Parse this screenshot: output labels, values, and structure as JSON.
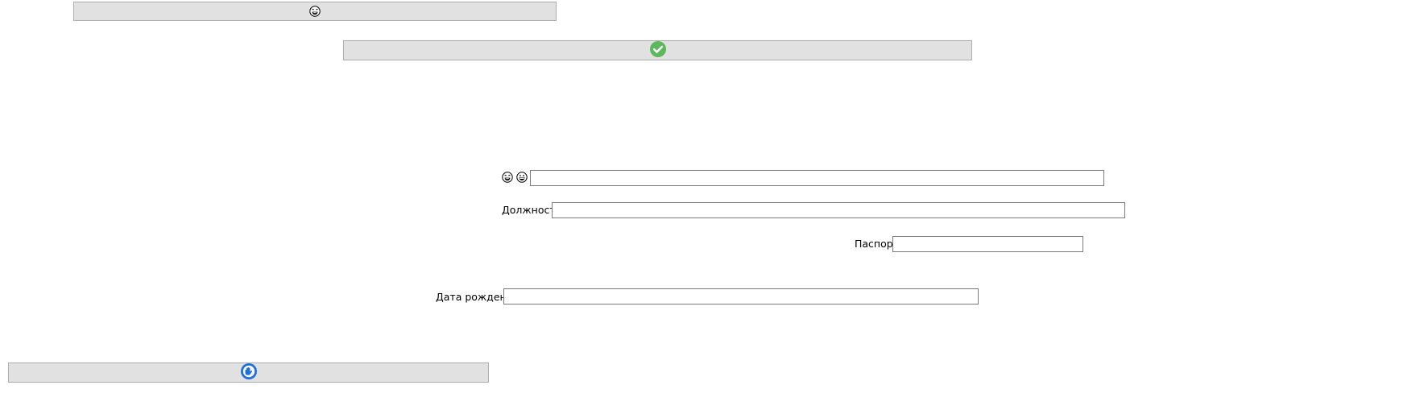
{
  "buttons": {
    "top_button_icon": "laughing-face-icon",
    "confirm_button_icon": "green-checkmark-icon",
    "bottom_button_icon": "blue-round-hand-icon"
  },
  "form": {
    "row1_icons": [
      "laughing-face-icon",
      "grinning-face-icon"
    ],
    "position_label": "Должность",
    "passport_label": "Паспорт",
    "birthdate_label": "Дата рождения",
    "row1_value": "",
    "position_value": "",
    "passport_value": "",
    "birthdate_value": ""
  },
  "colors": {
    "button_bg": "#e1e1e1",
    "check_green": "#5cb85c",
    "hand_blue": "#1e6fd9"
  }
}
